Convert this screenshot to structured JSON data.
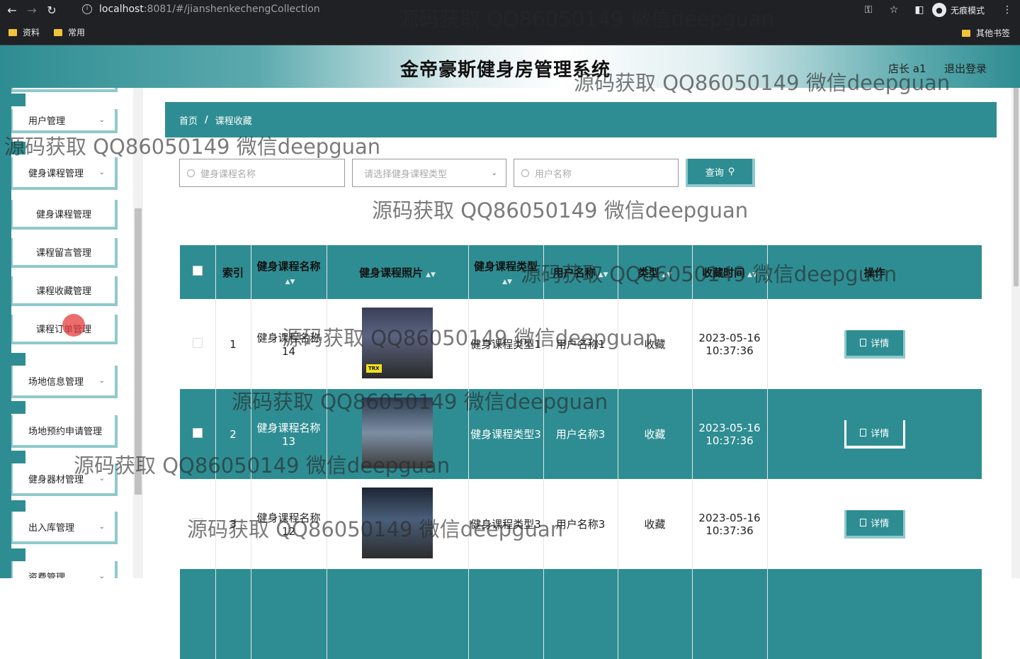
{
  "browser": {
    "url_host": "localhost",
    "url_path": ":8081/#/jianshenkechengCollection",
    "incognito_label": "无痕模式",
    "bookmarks": [
      "资料",
      "常用"
    ],
    "other_bookmarks": "其他书签"
  },
  "header": {
    "title": "金帝豪斯健身房管理系统",
    "user": "店长 a1",
    "logout": "退出登录"
  },
  "sidebar": {
    "groups": [
      {
        "label": "用户管理"
      },
      {
        "label": "健身课程管理"
      },
      {
        "label": "场地信息管理"
      },
      {
        "label": "场地预约申请管理"
      },
      {
        "label": "健身器材管理"
      },
      {
        "label": "出入库管理"
      },
      {
        "label": "资费管理"
      }
    ],
    "sub_items": [
      "健身课程管理",
      "课程留言管理",
      "课程收藏管理",
      "课程订单管理"
    ]
  },
  "breadcrumb": {
    "home": "首页",
    "separator": "/",
    "current": "课程收藏"
  },
  "search": {
    "course_name_placeholder": "健身课程名称",
    "course_type_placeholder": "请选择健身课程类型",
    "user_name_placeholder": "用户名称",
    "query_label": "查询"
  },
  "table": {
    "headers": {
      "index": "索引",
      "name": "健身课程名称",
      "photo": "健身课程照片",
      "type": "健身课程类型",
      "user": "用户名称",
      "kind": "类型",
      "time": "收藏时间",
      "action": "操作"
    },
    "rows": [
      {
        "index": "1",
        "name": "健身课程名称14",
        "type": "健身课程类型1",
        "user": "用户名称1",
        "kind": "收藏",
        "time": "2023-05-16 10:37:36",
        "action": "详情"
      },
      {
        "index": "2",
        "name": "健身课程名称13",
        "type": "健身课程类型3",
        "user": "用户名称3",
        "kind": "收藏",
        "time": "2023-05-16 10:37:36",
        "action": "详情"
      },
      {
        "index": "3",
        "name": "健身课程名称12",
        "type": "健身课程类型3",
        "user": "用户名称3",
        "kind": "收藏",
        "time": "2023-05-16 10:37:36",
        "action": "详情"
      }
    ],
    "photo_tag": "TRX"
  },
  "watermark": "源码获取 QQ86050149 微信deepguan",
  "colors": {
    "primary": "#2e8d92",
    "accent_border": "#8fc9cc"
  }
}
